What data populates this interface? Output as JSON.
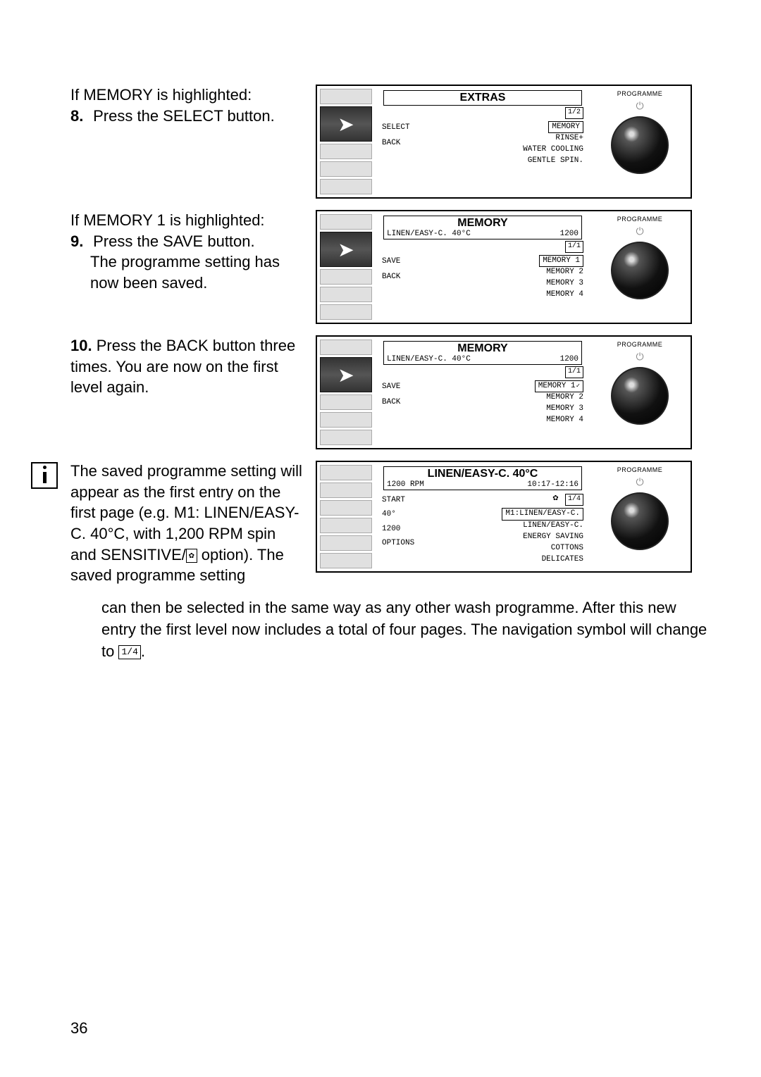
{
  "pageNumber": "36",
  "step8": {
    "intro": "If MEMORY is highlighted:",
    "num": "8.",
    "text": "Press the SELECT button."
  },
  "step9": {
    "intro": "If MEMORY 1 is highlighted:",
    "num": "9.",
    "text": "Press the SAVE button.",
    "text2": "The programme setting has now been saved."
  },
  "step10": {
    "num": "10.",
    "text": "Press the BACK button three times. You are now on the first level again."
  },
  "info": {
    "para1_a": "The saved programme set­ting will appear as the first entry on the first page (e.g. M1: LINEN/EASY-C. 40°C, with 1,200 RPM spin and SENSITIVE/",
    "para1_b": " option). The saved programme setting",
    "para2": "can then be selected in the same way as any other wash programme. After this new entry the first level now includes a total of four pages. The navigation symbol will change to ",
    "para2_end": "."
  },
  "panelCommon": {
    "programmeLabel": "PROGRAMME"
  },
  "panel1": {
    "title": "EXTRAS",
    "nav": "1/2",
    "labelTop": "SELECT",
    "labelBottom": "BACK",
    "items": [
      "MEMORY",
      "RINSE+",
      "WATER COOLING",
      "GENTLE SPIN."
    ]
  },
  "panel2": {
    "title": "MEMORY",
    "subLeft": "LINEN/EASY-C. 40°C",
    "subRight": "1200",
    "nav": "1/1",
    "labelTop": "SAVE",
    "labelBottom": "BACK",
    "items": [
      "MEMORY 1",
      "MEMORY 2",
      "MEMORY 3",
      "MEMORY 4"
    ]
  },
  "panel3": {
    "title": "MEMORY",
    "subLeft": "LINEN/EASY-C. 40°C",
    "subRight": "1200",
    "nav": "1/1",
    "labelTop": "SAVE",
    "labelBottom": "BACK",
    "items": [
      "MEMORY 1",
      "MEMORY 2",
      "MEMORY 3",
      "MEMORY 4"
    ]
  },
  "panel4": {
    "title": "LINEN/EASY-C. 40°C",
    "subLeft": "1200 RPM",
    "subRight": "10:17-12:16",
    "nav": "1/4",
    "labels": [
      "START",
      "40°",
      "1200",
      "OPTIONS"
    ],
    "items": [
      "M1:LINEN/EASY-C.",
      "LINEN/EASY-C.",
      "ENERGY SAVING",
      "COTTONS",
      "DELICATES"
    ]
  },
  "inlineSymbols": {
    "sensitive": "✿",
    "navChange": "1/4"
  }
}
